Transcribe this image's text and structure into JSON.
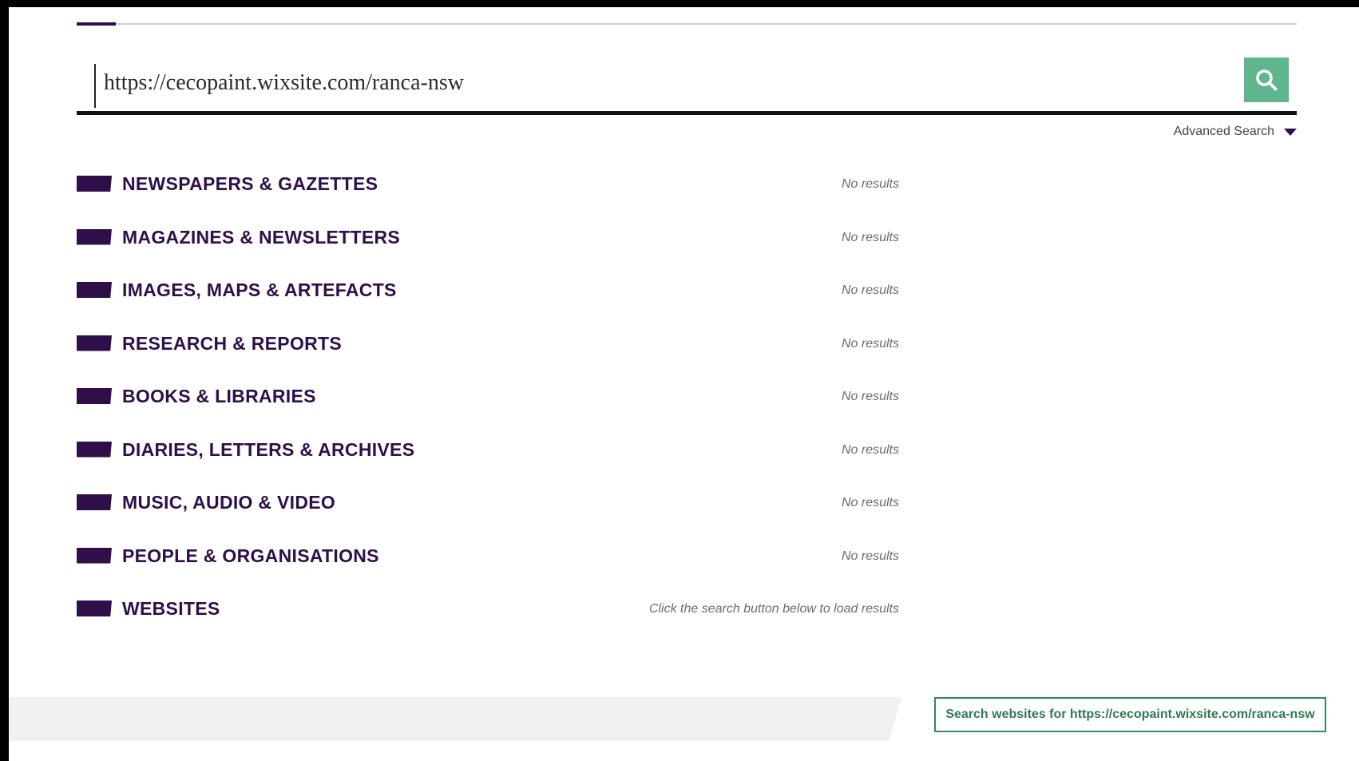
{
  "search": {
    "value": "https://cecopaint.wixsite.com/ranca-nsw",
    "button_icon": "search-icon"
  },
  "advanced_search": {
    "label": "Advanced Search",
    "icon": "caret-down-icon"
  },
  "categories": [
    {
      "label": "NEWSPAPERS & GAZETTES",
      "status": "No results"
    },
    {
      "label": "MAGAZINES & NEWSLETTERS",
      "status": "No results"
    },
    {
      "label": "IMAGES, MAPS & ARTEFACTS",
      "status": "No results"
    },
    {
      "label": "RESEARCH & REPORTS",
      "status": "No results"
    },
    {
      "label": "BOOKS & LIBRARIES",
      "status": "No results"
    },
    {
      "label": "DIARIES, LETTERS & ARCHIVES",
      "status": "No results"
    },
    {
      "label": "MUSIC, AUDIO & VIDEO",
      "status": "No results"
    },
    {
      "label": "PEOPLE & ORGANISATIONS",
      "status": "No results"
    },
    {
      "label": "WEBSITES",
      "status": "Click the search button below to load results"
    }
  ],
  "footer": {
    "websites_button_label": "Search websites for https://cecopaint.wixsite.com/ranca-nsw"
  },
  "colors": {
    "accent_purple": "#2e0f4a",
    "search_green": "#5fb58d",
    "button_green": "#2f8a5d"
  }
}
